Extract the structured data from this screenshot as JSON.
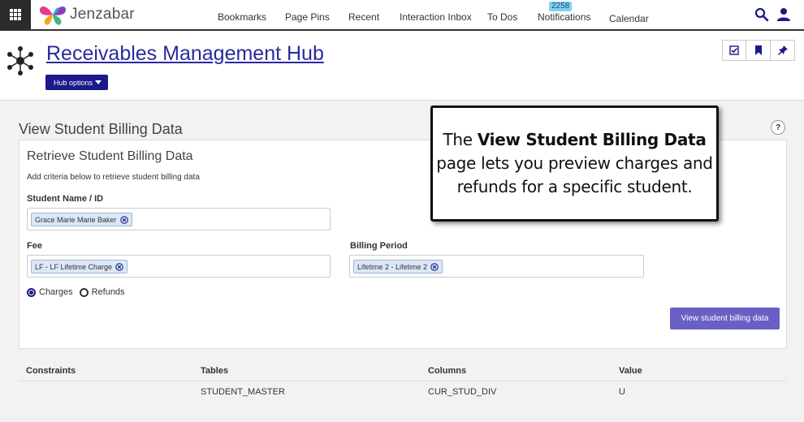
{
  "nav": {
    "logo_text": "Jenzabar",
    "items": [
      "Bookmarks",
      "Page Pins",
      "Recent",
      "Interaction Inbox",
      "To Dos",
      "Notifications",
      "Calendar"
    ],
    "notifications_count": "2258"
  },
  "hub": {
    "title": "Receivables Management Hub",
    "options_label": "Hub options"
  },
  "page": {
    "title": "View Student Billing Data",
    "help_label": "?"
  },
  "card": {
    "title": "Retrieve Student Billing Data",
    "subtitle": "Add criteria below to retrieve student billing data",
    "student_label": "Student Name / ID",
    "student_value": "Grace Marie Marie Baker",
    "fee_label": "Fee",
    "fee_value": "LF - LF Lifetime Charge",
    "period_label": "Billing Period",
    "period_value": "Lifetime 2 - Lifetime 2",
    "radio_charges": "Charges",
    "radio_refunds": "Refunds",
    "selected_radio": "Charges",
    "submit_label": "View student billing data"
  },
  "table": {
    "headers": [
      "Constraints",
      "Tables",
      "Columns",
      "Value"
    ],
    "rows": [
      [
        "",
        "STUDENT_MASTER",
        "CUR_STUD_DIV",
        "U"
      ]
    ]
  },
  "callout": {
    "prefix": "The ",
    "bold": "View Student Billing Data",
    "suffix": " page lets you preview charges and refunds for a specific student."
  },
  "colors": {
    "accent": "#1a1a8c",
    "button": "#6a5fc4",
    "title_link": "#2a2a9e",
    "badge": "#7fd1f5"
  }
}
